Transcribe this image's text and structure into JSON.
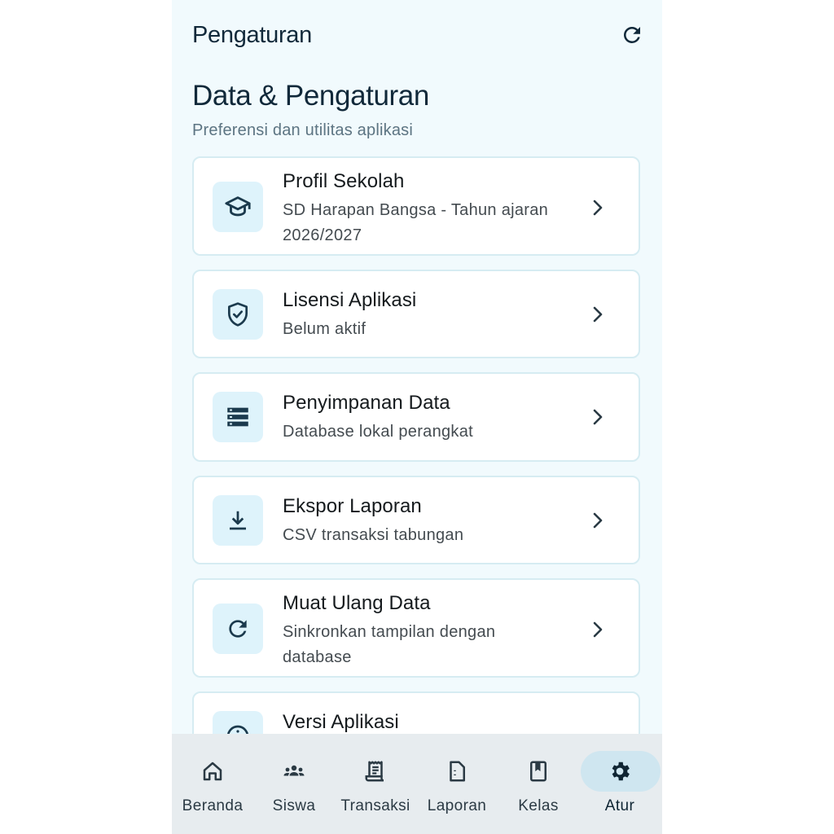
{
  "appbar": {
    "title": "Pengaturan",
    "refresh_icon": "refresh-icon"
  },
  "section": {
    "title": "Data & Pengaturan",
    "subtitle": "Preferensi dan utilitas aplikasi"
  },
  "items": [
    {
      "title": "Profil Sekolah",
      "subtitle": "SD Harapan Bangsa - Tahun ajaran 2026/2027",
      "icon": "graduation-cap-icon"
    },
    {
      "title": "Lisensi Aplikasi",
      "subtitle": "Belum aktif",
      "icon": "shield-check-icon"
    },
    {
      "title": "Penyimpanan Data",
      "subtitle": "Database lokal perangkat",
      "icon": "storage-icon"
    },
    {
      "title": "Ekspor Laporan",
      "subtitle": "CSV transaksi tabungan",
      "icon": "download-icon"
    },
    {
      "title": "Muat Ulang Data",
      "subtitle": "Sinkronkan tampilan dengan database",
      "icon": "refresh-icon"
    },
    {
      "title": "Versi Aplikasi",
      "subtitle": "",
      "icon": "info-icon"
    }
  ],
  "nav": [
    {
      "label": "Beranda",
      "icon": "home-icon",
      "active": false
    },
    {
      "label": "Siswa",
      "icon": "group-icon",
      "active": false
    },
    {
      "label": "Transaksi",
      "icon": "receipt-icon",
      "active": false
    },
    {
      "label": "Laporan",
      "icon": "document-icon",
      "active": false
    },
    {
      "label": "Kelas",
      "icon": "book-icon",
      "active": false
    },
    {
      "label": "Atur",
      "icon": "settings-icon",
      "active": true
    }
  ],
  "colors": {
    "background": "#f1fafd",
    "icon_bg": "#def3fb",
    "accent": "#11293a",
    "nav_active_pill": "#cfe6f0"
  }
}
